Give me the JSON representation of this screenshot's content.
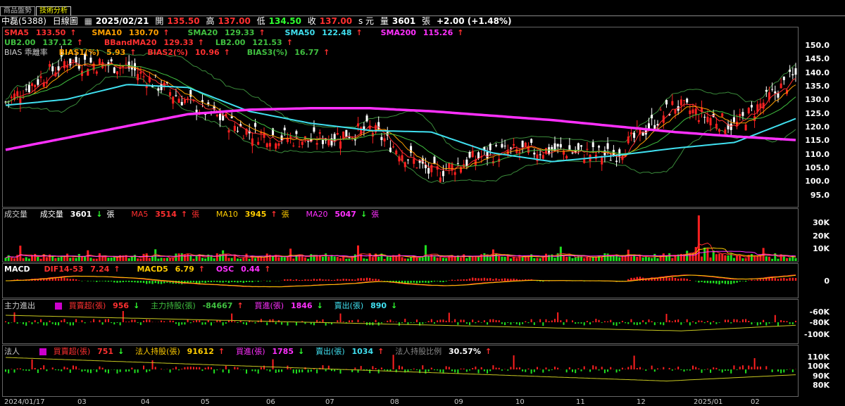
{
  "tabs": [
    {
      "label": "商品盤勢",
      "active": false
    },
    {
      "label": "技術分析",
      "active": true
    }
  ],
  "header": {
    "stock": "中磊(5388)",
    "chart_kind": "日線圖",
    "date": "2025/02/21",
    "open_label": "開",
    "open": "135.50",
    "high_label": "高",
    "high": "137.00",
    "low_label": "低",
    "low": "134.50",
    "close_label": "收",
    "close": "137.00",
    "unit": "s 元",
    "volume_label": "量",
    "volume": "3601",
    "volume_unit": "張",
    "change": "+2.00 (+1.48%)"
  },
  "price_panel": {
    "ma_line": [
      {
        "label": "SMA5",
        "value": "133.50",
        "arrow": "↑",
        "color": "#ff3030"
      },
      {
        "label": "SMA10",
        "value": "130.70",
        "arrow": "↑",
        "color": "#ffa000"
      },
      {
        "label": "SMA20",
        "value": "129.33",
        "arrow": "↑",
        "color": "#40c040"
      },
      {
        "label": "SMA50",
        "value": "122.48",
        "arrow": "↑",
        "color": "#40e0f0"
      },
      {
        "label": "SMA200",
        "value": "115.26",
        "arrow": "↑",
        "color": "#ff30ff"
      }
    ],
    "bb_line": [
      {
        "label": "UB2.00",
        "value": "137.12",
        "arrow": "↑",
        "color": "#40c040"
      },
      {
        "label": "BBandMA20",
        "value": "129.33",
        "arrow": "↑",
        "color": "#ff3030"
      },
      {
        "label": "LB2.00",
        "value": "121.53",
        "arrow": "↑",
        "color": "#40c040"
      }
    ],
    "bias_title": "BIAS 乖離率",
    "bias_line": [
      {
        "label": "BIAS1(%)",
        "value": "5.93",
        "arrow": "↑",
        "color": "#ffa000"
      },
      {
        "label": "BIAS2(%)",
        "value": "10.96",
        "arrow": "↑",
        "color": "#ff3030"
      },
      {
        "label": "BIAS3(%)",
        "value": "16.77",
        "arrow": "↑",
        "color": "#40c040"
      }
    ],
    "y_ticks": [
      "150.0",
      "145.0",
      "140.0",
      "135.0",
      "130.0",
      "125.0",
      "120.0",
      "115.0",
      "110.0",
      "105.0",
      "100.0",
      "95.0"
    ]
  },
  "volume_panel": {
    "title": "成交量",
    "items": [
      {
        "label": "成交量",
        "value": "3601",
        "arrow": "↓",
        "unit": "張",
        "color": "#ffffff"
      },
      {
        "label": "MA5",
        "value": "3514",
        "arrow": "↑",
        "unit": "張",
        "color": "#ff3030"
      },
      {
        "label": "MA10",
        "value": "3945",
        "arrow": "↑",
        "unit": "張",
        "color": "#ffcc00"
      },
      {
        "label": "MA20",
        "value": "5047",
        "arrow": "↓",
        "unit": "張",
        "color": "#ff30ff"
      }
    ],
    "y_ticks": [
      "30K",
      "20K",
      "10K"
    ]
  },
  "macd_panel": {
    "title": "MACD",
    "items": [
      {
        "label": "DIF14-53",
        "value": "7.24",
        "arrow": "↑",
        "color": "#ff3030"
      },
      {
        "label": "MACD5",
        "value": "6.79",
        "arrow": "↑",
        "color": "#ffcc00"
      },
      {
        "label": "OSC",
        "value": "0.44",
        "arrow": "↑",
        "color": "#ff30ff"
      }
    ],
    "y_ticks": [
      "0"
    ]
  },
  "main_force_panel": {
    "title": "主力進出",
    "items": [
      {
        "label": "買賣超(張)",
        "value": "956",
        "arrow": "↓",
        "color": "#ff3030"
      },
      {
        "label": "主力持股(張)",
        "value": "-84667",
        "arrow": "↑",
        "color": "#40c040"
      },
      {
        "label": "買進(張)",
        "value": "1846",
        "arrow": "↓",
        "color": "#ff30ff"
      },
      {
        "label": "賣出(張)",
        "value": "890",
        "arrow": "↓",
        "color": "#40e0f0"
      }
    ],
    "y_ticks": [
      "-60K",
      "-80K",
      "-100K"
    ]
  },
  "institutional_panel": {
    "title": "法人",
    "items": [
      {
        "label": "買賣超(張)",
        "value": "751",
        "arrow": "↓",
        "color": "#ff3030"
      },
      {
        "label": "法人持股(張)",
        "value": "91612",
        "arrow": "↑",
        "color": "#ffcc00"
      },
      {
        "label": "買進(張)",
        "value": "1785",
        "arrow": "↓",
        "color": "#ff30ff"
      },
      {
        "label": "賣出(張)",
        "value": "1034",
        "arrow": "↑",
        "color": "#40e0f0"
      },
      {
        "label": "法人持股比例",
        "value": "30.57%",
        "arrow": "↑",
        "color": "#888888"
      }
    ],
    "y_ticks": [
      "110K",
      "100K",
      "90K",
      "80K"
    ]
  },
  "x_ticks": [
    "2024/01/17",
    "03",
    "04",
    "05",
    "06",
    "07",
    "08",
    "09",
    "10",
    "11",
    "12",
    "2025/01",
    "02"
  ],
  "chart_data": {
    "type": "line",
    "title": "中磊(5388) 日線圖",
    "x": [
      "2024/01",
      "02",
      "03",
      "04",
      "05",
      "06",
      "07",
      "08",
      "09",
      "10",
      "11",
      "12",
      "2025/01",
      "02"
    ],
    "ylim": [
      93,
      153
    ],
    "series": [
      {
        "name": "SMA200",
        "values": [
          112,
          116,
          120,
          124,
          125.5,
          126,
          126,
          125,
          123.5,
          122,
          120,
          118,
          116.5,
          115.3
        ]
      },
      {
        "name": "SMA50",
        "values": [
          127,
          129,
          134,
          133,
          125,
          121,
          118.5,
          118,
          111,
          108,
          110,
          112.5,
          114.5,
          122.5
        ]
      },
      {
        "name": "Close",
        "values": [
          128,
          142,
          140,
          128,
          118,
          115,
          119,
          104,
          111,
          112,
          110,
          127,
          120,
          137
        ]
      }
    ],
    "volume": {
      "ylim": [
        0,
        35000
      ],
      "peak": 30000
    }
  }
}
